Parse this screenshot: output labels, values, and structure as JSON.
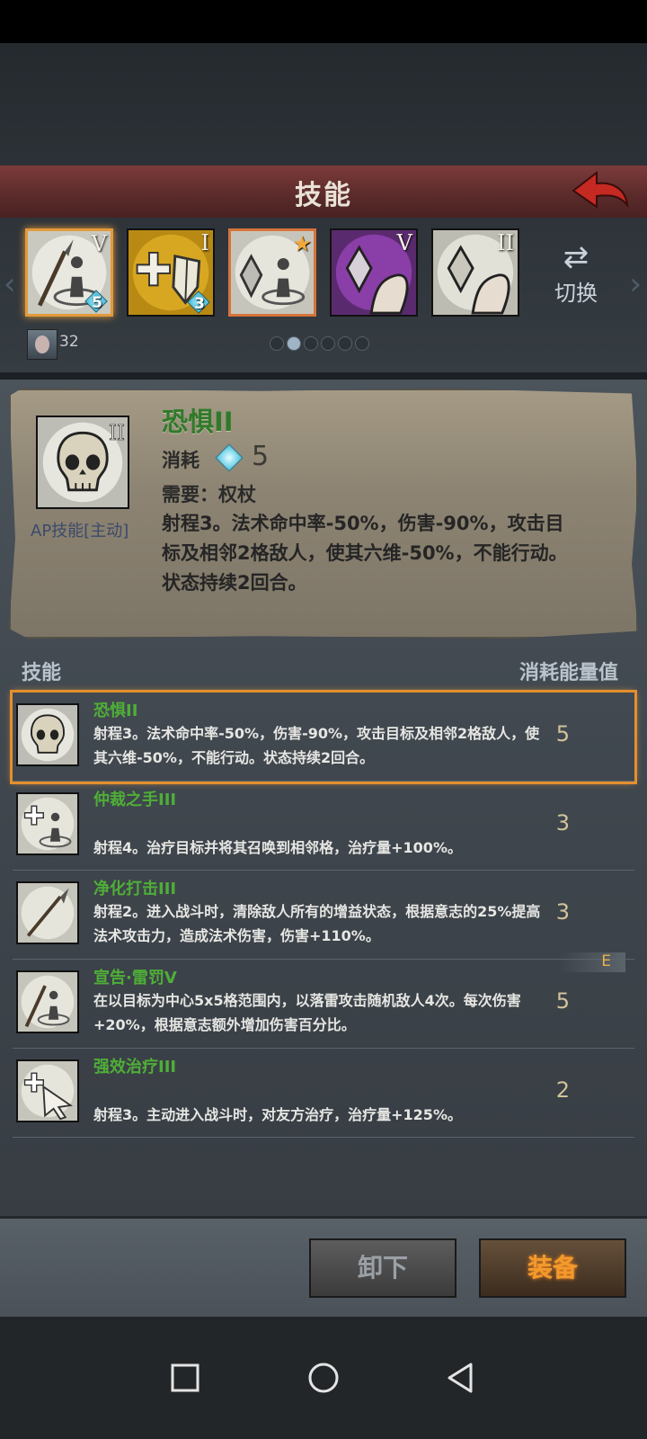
{
  "header": {
    "title": "技能"
  },
  "slots": [
    {
      "name": "slot-holy-spear",
      "roman": "V",
      "gem_count": "5",
      "selected": true
    },
    {
      "name": "slot-heal-shield",
      "roman": "I",
      "gem_count": "3"
    },
    {
      "name": "slot-crystal-star",
      "roman": ""
    },
    {
      "name": "slot-purple-crystal",
      "roman": "V"
    },
    {
      "name": "slot-crystal-arm",
      "roman": "II"
    }
  ],
  "switch": {
    "label": "切换"
  },
  "hero": {
    "level": "32"
  },
  "page_dots": {
    "count": 6,
    "active": 1
  },
  "detail": {
    "roman": "II",
    "type": "AP技能[主动]",
    "name": "恐惧II",
    "cost_label": "消耗",
    "cost_value": "5",
    "requirement": "需要：权杖",
    "description": "射程3。法术命中率-50%，伤害-90%，攻击目标及相邻2格敌人，使其六维-50%，不能行动。状态持续2回合。"
  },
  "list_header": {
    "left": "技能",
    "right": "消耗能量值"
  },
  "skills": [
    {
      "name": "恐惧II",
      "desc": "射程3。法术命中率-50%，伤害-90%，攻击目标及相邻2格敌人，使其六维-50%，不能行动。状态持续2回合。",
      "cost": "5",
      "tag": ""
    },
    {
      "name": "仲裁之手III",
      "desc": "射程4。治疗目标并将其召唤到相邻格，治疗量+100%。",
      "cost": "3",
      "tag": ""
    },
    {
      "name": "净化打击III",
      "desc": "射程2。进入战斗时，清除敌人所有的增益状态，根据意志的25%提高法术攻击力，造成法术伤害，伤害+110%。",
      "cost": "3",
      "tag": ""
    },
    {
      "name": "宣告·雷罚V",
      "desc": "在以目标为中心5x5格范围内，以落雷攻击随机敌人4次。每次伤害+20%，根据意志额外增加伤害百分比。",
      "cost": "5",
      "tag": "E"
    },
    {
      "name": "强效治疗III",
      "desc": "射程3。主动进入战斗时，对友方治疗，治疗量+125%。",
      "cost": "2",
      "tag": ""
    }
  ],
  "buttons": {
    "unequip": "卸下",
    "equip": "装备"
  }
}
